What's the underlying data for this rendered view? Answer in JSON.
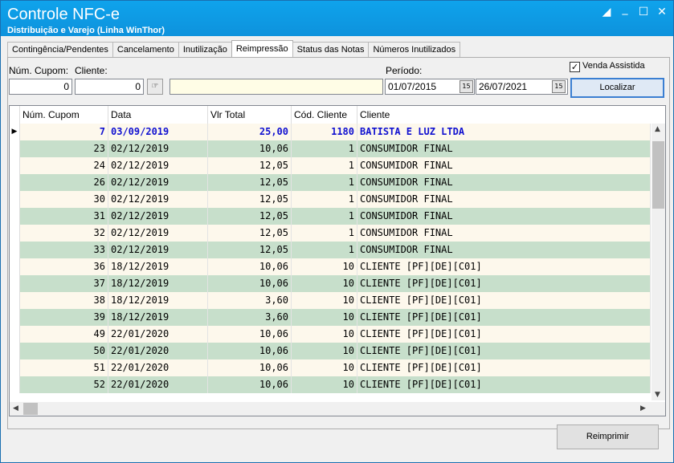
{
  "window": {
    "title": "Controle NFC-e",
    "subtitle": "Distribuição e Varejo (Linha WinThor)"
  },
  "tabs": [
    "Contingência/Pendentes",
    "Cancelamento",
    "Inutilização",
    "Reimpressão",
    "Status das Notas",
    "Números Inutilizados"
  ],
  "active_tab": "Reimpressão",
  "filters": {
    "num_cupom_label": "Núm. Cupom:",
    "num_cupom_value": "0",
    "cliente_label": "Cliente:",
    "cliente_code_value": "0",
    "cliente_name_value": "",
    "periodo_label": "Período:",
    "date_from": "01/07/2015",
    "date_to": "26/07/2021",
    "venda_assistida_label": "Venda Assistida",
    "venda_assistida_checked": true,
    "localizar_label": "Localizar"
  },
  "grid": {
    "columns": [
      "Núm. Cupom",
      "Data",
      "Vlr Total",
      "Cód. Cliente",
      "Cliente"
    ],
    "rows": [
      [
        "7",
        "03/09/2019",
        "25,00",
        "1180",
        "BATISTA E LUZ LTDA"
      ],
      [
        "23",
        "02/12/2019",
        "10,06",
        "1",
        "CONSUMIDOR FINAL"
      ],
      [
        "24",
        "02/12/2019",
        "12,05",
        "1",
        "CONSUMIDOR FINAL"
      ],
      [
        "26",
        "02/12/2019",
        "12,05",
        "1",
        "CONSUMIDOR FINAL"
      ],
      [
        "30",
        "02/12/2019",
        "12,05",
        "1",
        "CONSUMIDOR FINAL"
      ],
      [
        "31",
        "02/12/2019",
        "12,05",
        "1",
        "CONSUMIDOR FINAL"
      ],
      [
        "32",
        "02/12/2019",
        "12,05",
        "1",
        "CONSUMIDOR FINAL"
      ],
      [
        "33",
        "02/12/2019",
        "12,05",
        "1",
        "CONSUMIDOR FINAL"
      ],
      [
        "36",
        "18/12/2019",
        "10,06",
        "10",
        "CLIENTE [PF][DE][C01]"
      ],
      [
        "37",
        "18/12/2019",
        "10,06",
        "10",
        "CLIENTE [PF][DE][C01]"
      ],
      [
        "38",
        "18/12/2019",
        "3,60",
        "10",
        "CLIENTE [PF][DE][C01]"
      ],
      [
        "39",
        "18/12/2019",
        "3,60",
        "10",
        "CLIENTE [PF][DE][C01]"
      ],
      [
        "49",
        "22/01/2020",
        "10,06",
        "10",
        "CLIENTE [PF][DE][C01]"
      ],
      [
        "50",
        "22/01/2020",
        "10,06",
        "10",
        "CLIENTE [PF][DE][C01]"
      ],
      [
        "51",
        "22/01/2020",
        "10,06",
        "10",
        "CLIENTE [PF][DE][C01]"
      ],
      [
        "52",
        "22/01/2020",
        "10,06",
        "10",
        "CLIENTE [PF][DE][C01]"
      ]
    ]
  },
  "reimprimir_label": "Reimprimir",
  "colors": {
    "title_bar": "#0d92dc",
    "row_selected_text": "#1010d0",
    "row_even": "#fdf8ec",
    "row_odd": "#c7dfcb"
  }
}
